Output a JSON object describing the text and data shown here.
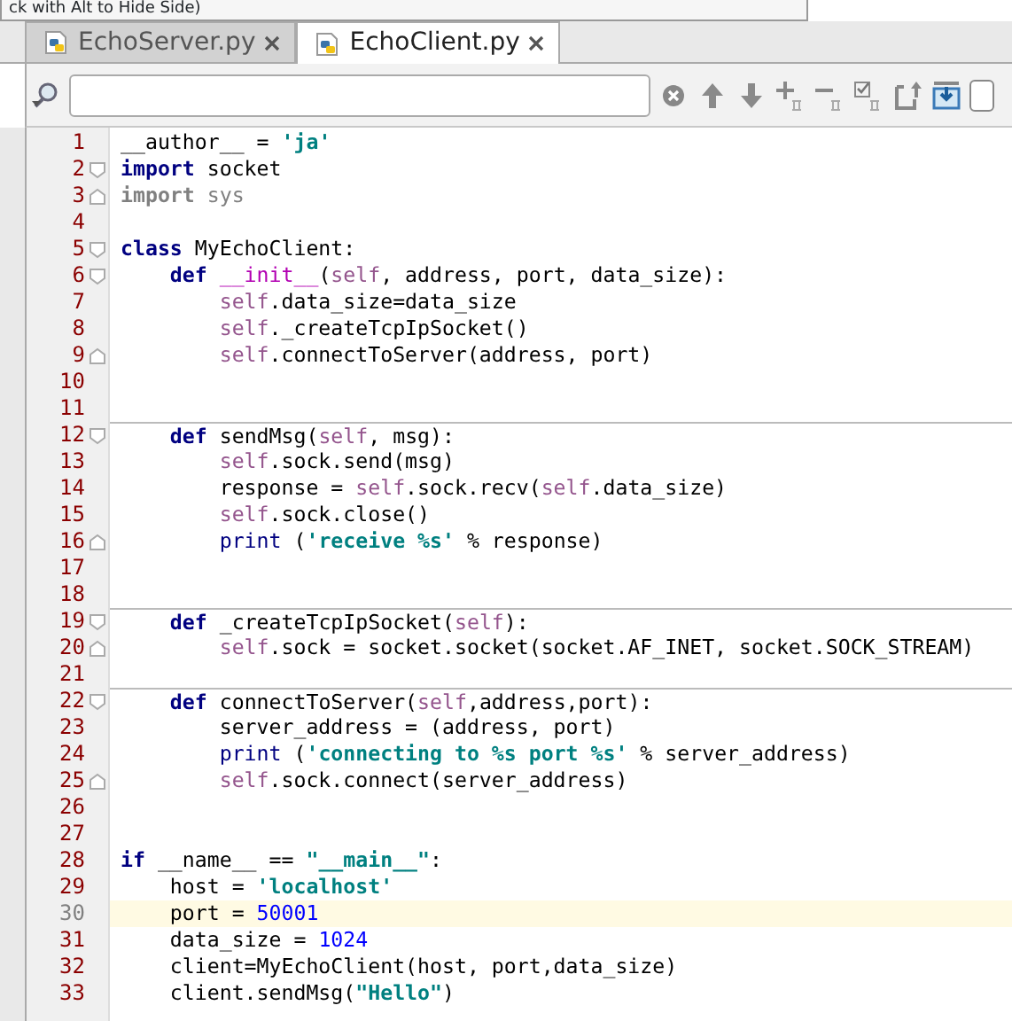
{
  "tooltip": "ck with Alt to Hide Side)",
  "tabs": [
    {
      "label": "EchoServer.py",
      "selected": false
    },
    {
      "label": "EchoClient.py",
      "selected": true
    }
  ],
  "toolbar": {
    "checkbox": {
      "checked": false
    }
  },
  "lines": [
    {
      "number": "1",
      "current": false,
      "separator": false,
      "fold_start": false,
      "fold_end": false,
      "tokens": [
        {
          "kind": "plain",
          "text": "__author__ = "
        },
        {
          "kind": "str",
          "text": "'ja'"
        }
      ]
    },
    {
      "number": "2",
      "current": false,
      "separator": false,
      "fold_start": true,
      "fold_end": false,
      "tokens": [
        {
          "kind": "kw",
          "text": "import"
        },
        {
          "kind": "plain",
          "text": " socket"
        }
      ]
    },
    {
      "number": "3",
      "current": false,
      "separator": false,
      "fold_start": false,
      "fold_end": true,
      "tokens": [
        {
          "kind": "graykw",
          "text": "import"
        },
        {
          "kind": "gray",
          "text": " sys"
        }
      ]
    },
    {
      "number": "4",
      "current": false,
      "separator": false,
      "fold_start": false,
      "fold_end": false
    },
    {
      "number": "5",
      "current": false,
      "separator": false,
      "fold_start": true,
      "fold_end": false,
      "tokens": [
        {
          "kind": "kw",
          "text": "class"
        },
        {
          "kind": "plain",
          "text": " MyEchoClient:"
        }
      ]
    },
    {
      "number": "6",
      "current": false,
      "separator": false,
      "fold_start": true,
      "fold_end": false,
      "tokens": [
        {
          "kind": "kw",
          "text": "    def "
        },
        {
          "kind": "magic",
          "text": "__init__"
        },
        {
          "kind": "plain",
          "text": "("
        },
        {
          "kind": "self",
          "text": "self"
        },
        {
          "kind": "plain",
          "text": ", address, port, data_size):"
        }
      ]
    },
    {
      "number": "7",
      "current": false,
      "separator": false,
      "fold_start": false,
      "fold_end": false,
      "tokens": [
        {
          "kind": "self",
          "text": "        self"
        },
        {
          "kind": "plain",
          "text": ".data_size=data_size"
        }
      ]
    },
    {
      "number": "8",
      "current": false,
      "separator": false,
      "fold_start": false,
      "fold_end": false,
      "tokens": [
        {
          "kind": "self",
          "text": "        self"
        },
        {
          "kind": "plain",
          "text": "._createTcpIpSocket()"
        }
      ]
    },
    {
      "number": "9",
      "current": false,
      "separator": false,
      "fold_start": false,
      "fold_end": true,
      "tokens": [
        {
          "kind": "self",
          "text": "        self"
        },
        {
          "kind": "plain",
          "text": ".connectToServer(address, port)"
        }
      ]
    },
    {
      "number": "10",
      "current": false,
      "separator": false,
      "fold_start": false,
      "fold_end": false
    },
    {
      "number": "11",
      "current": false,
      "separator": false,
      "fold_start": false,
      "fold_end": false
    },
    {
      "number": "12",
      "current": false,
      "separator": true,
      "fold_start": true,
      "fold_end": false,
      "tokens": [
        {
          "kind": "kw",
          "text": "    def"
        },
        {
          "kind": "plain",
          "text": " sendMsg("
        },
        {
          "kind": "self",
          "text": "self"
        },
        {
          "kind": "plain",
          "text": ", msg):"
        }
      ]
    },
    {
      "number": "13",
      "current": false,
      "separator": false,
      "fold_start": false,
      "fold_end": false,
      "tokens": [
        {
          "kind": "self",
          "text": "        self"
        },
        {
          "kind": "plain",
          "text": ".sock.send(msg)"
        }
      ]
    },
    {
      "number": "14",
      "current": false,
      "separator": false,
      "fold_start": false,
      "fold_end": false,
      "tokens": [
        {
          "kind": "plain",
          "text": "        response = "
        },
        {
          "kind": "self",
          "text": "self"
        },
        {
          "kind": "plain",
          "text": ".sock.recv("
        },
        {
          "kind": "self",
          "text": "self"
        },
        {
          "kind": "plain",
          "text": ".data_size)"
        }
      ]
    },
    {
      "number": "15",
      "current": false,
      "separator": false,
      "fold_start": false,
      "fold_end": false,
      "tokens": [
        {
          "kind": "self",
          "text": "        self"
        },
        {
          "kind": "plain",
          "text": ".sock.close()"
        }
      ]
    },
    {
      "number": "16",
      "current": false,
      "separator": false,
      "fold_start": false,
      "fold_end": true,
      "tokens": [
        {
          "kind": "builtin",
          "text": "        print"
        },
        {
          "kind": "plain",
          "text": " ("
        },
        {
          "kind": "str",
          "text": "'receive %s'"
        },
        {
          "kind": "plain",
          "text": " % response)"
        }
      ]
    },
    {
      "number": "17",
      "current": false,
      "separator": false,
      "fold_start": false,
      "fold_end": false
    },
    {
      "number": "18",
      "current": false,
      "separator": false,
      "fold_start": false,
      "fold_end": false
    },
    {
      "number": "19",
      "current": false,
      "separator": true,
      "fold_start": true,
      "fold_end": false,
      "tokens": [
        {
          "kind": "kw",
          "text": "    def"
        },
        {
          "kind": "plain",
          "text": " _createTcpIpSocket("
        },
        {
          "kind": "self",
          "text": "self"
        },
        {
          "kind": "plain",
          "text": "):"
        }
      ]
    },
    {
      "number": "20",
      "current": false,
      "separator": false,
      "fold_start": false,
      "fold_end": true,
      "tokens": [
        {
          "kind": "self",
          "text": "        self"
        },
        {
          "kind": "plain",
          "text": ".sock = socket.socket(socket.AF_INET, socket.SOCK_STREAM)"
        }
      ]
    },
    {
      "number": "21",
      "current": false,
      "separator": false,
      "fold_start": false,
      "fold_end": false
    },
    {
      "number": "22",
      "current": false,
      "separator": true,
      "fold_start": true,
      "fold_end": false,
      "tokens": [
        {
          "kind": "kw",
          "text": "    def"
        },
        {
          "kind": "plain",
          "text": " connectToServer("
        },
        {
          "kind": "self",
          "text": "self"
        },
        {
          "kind": "plain",
          "text": ",address,port):"
        }
      ]
    },
    {
      "number": "23",
      "current": false,
      "separator": false,
      "fold_start": false,
      "fold_end": false,
      "tokens": [
        {
          "kind": "plain",
          "text": "        server_address = (address, port)"
        }
      ]
    },
    {
      "number": "24",
      "current": false,
      "separator": false,
      "fold_start": false,
      "fold_end": false,
      "tokens": [
        {
          "kind": "builtin",
          "text": "        print"
        },
        {
          "kind": "plain",
          "text": " ("
        },
        {
          "kind": "str",
          "text": "'connecting to %s port %s'"
        },
        {
          "kind": "plain",
          "text": " % server_address)"
        }
      ]
    },
    {
      "number": "25",
      "current": false,
      "separator": false,
      "fold_start": false,
      "fold_end": true,
      "tokens": [
        {
          "kind": "self",
          "text": "        self"
        },
        {
          "kind": "plain",
          "text": ".sock.connect(server_address)"
        }
      ]
    },
    {
      "number": "26",
      "current": false,
      "separator": false,
      "fold_start": false,
      "fold_end": false
    },
    {
      "number": "27",
      "current": false,
      "separator": false,
      "fold_start": false,
      "fold_end": false
    },
    {
      "number": "28",
      "current": false,
      "separator": false,
      "fold_start": false,
      "fold_end": false,
      "tokens": [
        {
          "kind": "kw",
          "text": "if"
        },
        {
          "kind": "plain",
          "text": " __name__ == "
        },
        {
          "kind": "str",
          "text": "\"__main__\""
        },
        {
          "kind": "plain",
          "text": ":"
        }
      ]
    },
    {
      "number": "29",
      "current": false,
      "separator": false,
      "fold_start": false,
      "fold_end": false,
      "tokens": [
        {
          "kind": "plain",
          "text": "    host = "
        },
        {
          "kind": "str",
          "text": "'localhost'"
        }
      ]
    },
    {
      "number": "30",
      "current": true,
      "separator": false,
      "fold_start": false,
      "fold_end": false,
      "tokens": [
        {
          "kind": "plain",
          "text": "    port = "
        },
        {
          "kind": "num",
          "text": "50001"
        }
      ]
    },
    {
      "number": "31",
      "current": false,
      "separator": false,
      "fold_start": false,
      "fold_end": false,
      "tokens": [
        {
          "kind": "plain",
          "text": "    data_size = "
        },
        {
          "kind": "num",
          "text": "1024"
        }
      ]
    },
    {
      "number": "32",
      "current": false,
      "separator": false,
      "fold_start": false,
      "fold_end": false,
      "tokens": [
        {
          "kind": "plain",
          "text": "    client=MyEchoClient(host, port,data_size)"
        }
      ]
    },
    {
      "number": "33",
      "current": false,
      "separator": false,
      "fold_start": false,
      "fold_end": false,
      "tokens": [
        {
          "kind": "plain",
          "text": "    client.sendMsg("
        },
        {
          "kind": "str",
          "text": "\"Hello\""
        },
        {
          "kind": "plain",
          "text": ")"
        }
      ]
    }
  ]
}
